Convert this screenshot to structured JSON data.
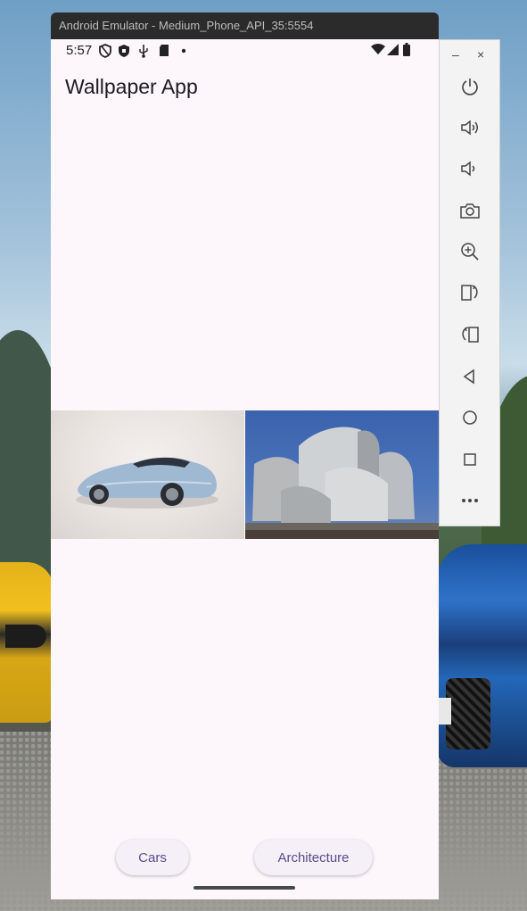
{
  "window": {
    "title": "Android Emulator - Medium_Phone_API_35:5554"
  },
  "status_bar": {
    "time": "5:57",
    "left_icons": [
      "shield-icon",
      "vpn-shield-icon",
      "usb-icon",
      "sd-card-icon",
      "dot-icon"
    ],
    "right_icons": [
      "wifi-icon",
      "signal-icon",
      "battery-icon"
    ]
  },
  "app": {
    "title": "Wallpaper App",
    "gallery": [
      {
        "name": "car-image",
        "subject": "silver sports car"
      },
      {
        "name": "architecture-image",
        "subject": "metallic curved building"
      }
    ],
    "buttons": {
      "cars": "Cars",
      "architecture": "Architecture"
    }
  },
  "emulator_toolbar": {
    "minimize": "–",
    "close": "×",
    "tools": [
      "power-icon",
      "volume-up-icon",
      "volume-down-icon",
      "camera-icon",
      "zoom-icon",
      "rotate-left-icon",
      "rotate-right-icon",
      "back-icon",
      "home-icon",
      "overview-icon",
      "more-icon"
    ]
  },
  "colors": {
    "app_background": "#fdf7fc",
    "chip_text": "#5c4b8c",
    "titlebar": "#2b2b2b"
  }
}
